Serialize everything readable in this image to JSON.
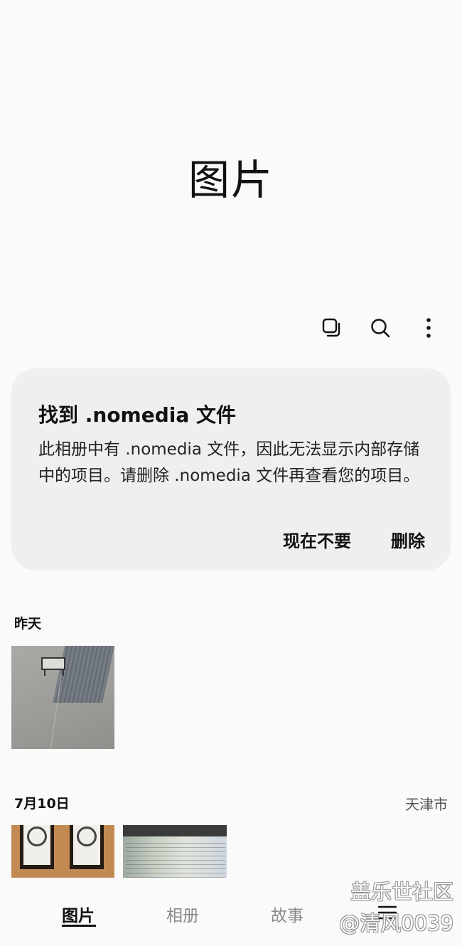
{
  "page": {
    "title": "图片"
  },
  "toolbar": {
    "icons": [
      "select-icon",
      "search-icon",
      "more-icon"
    ]
  },
  "notice": {
    "title": "找到 .nomedia 文件",
    "body": "此相册中有 .nomedia 文件，因此无法显示内部存储中的项目。请删除 .nomedia 文件再查看您的项目。",
    "dismiss_label": "现在不要",
    "delete_label": "删除"
  },
  "sections": [
    {
      "date": "昨天",
      "location": ""
    },
    {
      "date": "7月10日",
      "location": "天津市"
    }
  ],
  "nav": {
    "tabs": [
      "图片",
      "相册",
      "故事"
    ],
    "active_index": 0
  },
  "watermark": {
    "line1": "盖乐世社区",
    "line2": "@清风0039"
  }
}
